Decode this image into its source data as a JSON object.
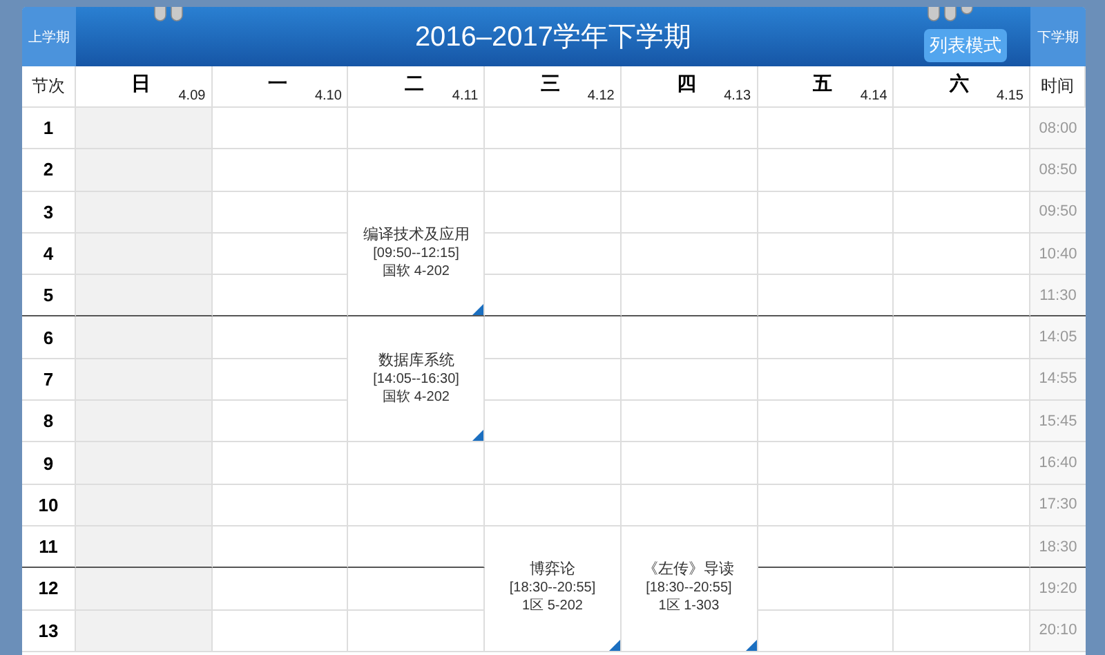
{
  "header": {
    "prev_term": "上学期",
    "title": "2016–2017学年下学期",
    "list_mode_button": "列表模式",
    "next_term": "下学期"
  },
  "corner_label": "节次",
  "time_label": "时间",
  "days": [
    {
      "name": "日",
      "date": "4.09",
      "today": true
    },
    {
      "name": "一",
      "date": "4.10",
      "today": false
    },
    {
      "name": "二",
      "date": "4.11",
      "today": false
    },
    {
      "name": "三",
      "date": "4.12",
      "today": false
    },
    {
      "name": "四",
      "date": "4.13",
      "today": false
    },
    {
      "name": "五",
      "date": "4.14",
      "today": false
    },
    {
      "name": "六",
      "date": "4.15",
      "today": false
    }
  ],
  "rows": [
    {
      "period": "1",
      "time": "08:00",
      "section_end": false,
      "cells": [
        {
          "kind": "empty"
        },
        {
          "kind": "empty"
        },
        {
          "kind": "empty"
        },
        {
          "kind": "empty"
        },
        {
          "kind": "empty"
        },
        {
          "kind": "empty"
        },
        {
          "kind": "empty"
        }
      ]
    },
    {
      "period": "2",
      "time": "08:50",
      "section_end": false,
      "cells": [
        {
          "kind": "empty"
        },
        {
          "kind": "empty"
        },
        {
          "kind": "empty"
        },
        {
          "kind": "empty"
        },
        {
          "kind": "empty"
        },
        {
          "kind": "empty"
        },
        {
          "kind": "empty"
        }
      ]
    },
    {
      "period": "3",
      "time": "09:50",
      "section_end": false,
      "cells": [
        {
          "kind": "empty"
        },
        {
          "kind": "empty"
        },
        {
          "kind": "course",
          "name": "编译技术及应用",
          "time": "[09:50--12:15]",
          "room": "国软 4-202"
        },
        {
          "kind": "empty"
        },
        {
          "kind": "empty"
        },
        {
          "kind": "empty"
        },
        {
          "kind": "empty"
        }
      ]
    },
    {
      "period": "4",
      "time": "10:40",
      "section_end": false,
      "cells": [
        {
          "kind": "empty"
        },
        {
          "kind": "empty"
        },
        {
          "kind": "continued"
        },
        {
          "kind": "empty"
        },
        {
          "kind": "empty"
        },
        {
          "kind": "empty"
        },
        {
          "kind": "empty"
        }
      ]
    },
    {
      "period": "5",
      "time": "11:30",
      "section_end": true,
      "cells": [
        {
          "kind": "empty"
        },
        {
          "kind": "empty"
        },
        {
          "kind": "continued"
        },
        {
          "kind": "empty"
        },
        {
          "kind": "empty"
        },
        {
          "kind": "empty"
        },
        {
          "kind": "empty"
        }
      ]
    },
    {
      "period": "6",
      "time": "14:05",
      "section_end": false,
      "cells": [
        {
          "kind": "empty"
        },
        {
          "kind": "empty"
        },
        {
          "kind": "course",
          "name": "数据库系统",
          "time": "[14:05--16:30]",
          "room": "国软 4-202"
        },
        {
          "kind": "empty"
        },
        {
          "kind": "empty"
        },
        {
          "kind": "empty"
        },
        {
          "kind": "empty"
        }
      ]
    },
    {
      "period": "7",
      "time": "14:55",
      "section_end": false,
      "cells": [
        {
          "kind": "empty"
        },
        {
          "kind": "empty"
        },
        {
          "kind": "continued"
        },
        {
          "kind": "empty"
        },
        {
          "kind": "empty"
        },
        {
          "kind": "empty"
        },
        {
          "kind": "empty"
        }
      ]
    },
    {
      "period": "8",
      "time": "15:45",
      "section_end": false,
      "cells": [
        {
          "kind": "empty"
        },
        {
          "kind": "empty"
        },
        {
          "kind": "continued"
        },
        {
          "kind": "empty"
        },
        {
          "kind": "empty"
        },
        {
          "kind": "empty"
        },
        {
          "kind": "empty"
        }
      ]
    },
    {
      "period": "9",
      "time": "16:40",
      "section_end": false,
      "cells": [
        {
          "kind": "empty"
        },
        {
          "kind": "empty"
        },
        {
          "kind": "empty"
        },
        {
          "kind": "empty"
        },
        {
          "kind": "empty"
        },
        {
          "kind": "empty"
        },
        {
          "kind": "empty"
        }
      ]
    },
    {
      "period": "10",
      "time": "17:30",
      "section_end": false,
      "cells": [
        {
          "kind": "empty"
        },
        {
          "kind": "empty"
        },
        {
          "kind": "empty"
        },
        {
          "kind": "empty"
        },
        {
          "kind": "empty"
        },
        {
          "kind": "empty"
        },
        {
          "kind": "empty"
        }
      ]
    },
    {
      "period": "11",
      "time": "18:30",
      "section_end": true,
      "cells": [
        {
          "kind": "empty"
        },
        {
          "kind": "empty"
        },
        {
          "kind": "empty"
        },
        {
          "kind": "course",
          "name": "博弈论",
          "time": "[18:30--20:55]",
          "room": "1区 5-202"
        },
        {
          "kind": "course",
          "name": "《左传》导读",
          "time": "[18:30--20:55]",
          "room": "1区 1-303"
        },
        {
          "kind": "empty"
        },
        {
          "kind": "empty"
        }
      ]
    },
    {
      "period": "12",
      "time": "19:20",
      "section_end": false,
      "cells": [
        {
          "kind": "empty"
        },
        {
          "kind": "empty"
        },
        {
          "kind": "empty"
        },
        {
          "kind": "continued"
        },
        {
          "kind": "continued"
        },
        {
          "kind": "empty"
        },
        {
          "kind": "empty"
        }
      ]
    },
    {
      "period": "13",
      "time": "20:10",
      "section_end": false,
      "cells": [
        {
          "kind": "empty"
        },
        {
          "kind": "empty"
        },
        {
          "kind": "empty"
        },
        {
          "kind": "continued"
        },
        {
          "kind": "continued"
        },
        {
          "kind": "empty"
        },
        {
          "kind": "empty"
        }
      ]
    }
  ]
}
